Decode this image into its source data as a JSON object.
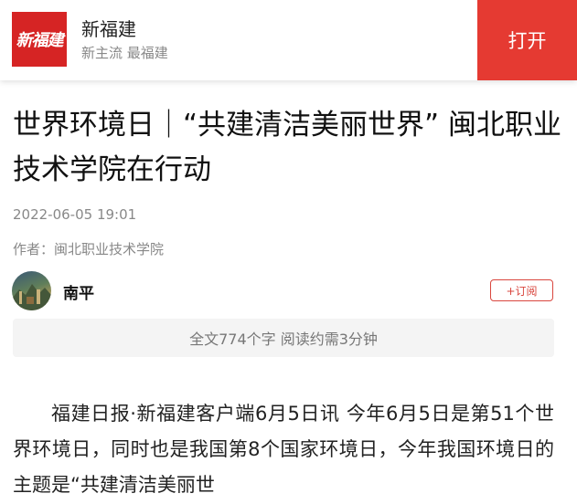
{
  "header": {
    "logo_text": "新福建",
    "app_name": "新福建",
    "slogan": "新主流 最福建",
    "open_label": "打开"
  },
  "article": {
    "title": "世界环境日｜“共建清洁美丽世界” 闽北职业技术学院在行动",
    "date": "2022-06-05 19:01",
    "author": "作者：闽北职业技术学院",
    "channel": "南平",
    "subscribe_label": "+订阅",
    "read_info": "全文774个字 阅读约需3分钟",
    "body": "福建日报·新福建客户端6月5日讯 今年6月5日是第51个世界环境日，同时也是我国第8个国家环境日，今年我国环境日的主题是“共建清洁美丽世"
  },
  "colors": {
    "brand_red": "#e53a32",
    "logo_red": "#d62424"
  }
}
